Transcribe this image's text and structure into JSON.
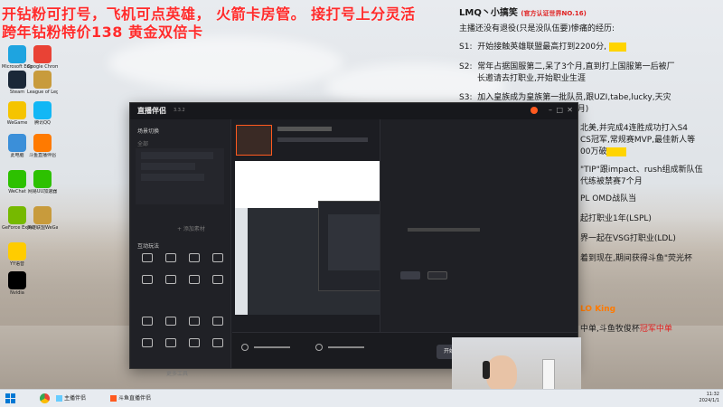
{
  "overlay": {
    "line1": "开钻粉可打号，飞机可点英雄，  火箭卡房管。  接打号上分灵活",
    "line2": "跨年钻粉特价138   黄金双倍卡"
  },
  "info_panel": {
    "title": "LMQ丶小搞笑",
    "title_tag": "(官方认证世界NO.16)",
    "subtitle": "主播还没有退役(只是没队伍要)惨痛的经历:",
    "s1_label": "S1:",
    "s1_text": "开始接触英雄联盟最高打到2200分,",
    "s2_label": "S2:",
    "s2_text": "常年占据国服第二,呆了3个月,直到打上国服第一后被厂",
    "s2_text2": "长邀请去打职业,开始职业生涯",
    "s3_label": "S3:",
    "s3_text": "加入皇族成为皇族第一批队员,跟UZI,tabe,lucky,天灾",
    "s3_text2": "3个月)",
    "line_a": "北美,并完成4连胜成功打入S4",
    "line_b": "CS冠军,常规赛MVP,最佳新人等",
    "line_c": "00万破",
    "line_d": "\"TIP\"跟impact、rush组成新队伍",
    "line_e": "代练被禁赛7个月",
    "line_f": "PL OMD战队当",
    "line_g": "起打职业1年(LSPL)",
    "line_h": "界一起在VSG打职业(LDL)",
    "line_i": "着到现在,期间获得斗鱼\"荧光杯",
    "line_j": "LO King",
    "line_k": "中单,斗鱼牧俊杯",
    "line_k_hl": "冠军中单"
  },
  "desktop_icons": [
    {
      "label": "Microsoft Edge",
      "color": "#1ea4e0"
    },
    {
      "label": "Google Chrome",
      "color": "#e94235"
    },
    {
      "label": "Steam",
      "color": "#1b2838"
    },
    {
      "label": "League of Legends",
      "color": "#c89b3c"
    },
    {
      "label": "WeGame",
      "color": "#f5c400"
    },
    {
      "label": "腾讯QQ",
      "color": "#12b7f5"
    },
    {
      "label": "此电脑",
      "color": "#3b8fd9"
    },
    {
      "label": "斗鱼直播伴侣",
      "color": "#ff7a00"
    },
    {
      "label": "WeChat",
      "color": "#2dc100"
    },
    {
      "label": "网易UU加速器",
      "color": "#2dc100"
    },
    {
      "label": "GeForce Experience",
      "color": "#76b900"
    },
    {
      "label": "英雄联盟WeGame版",
      "color": "#c89b3c"
    },
    {
      "label": "YY语音",
      "color": "#ffcc00"
    },
    {
      "label": "Nvidia",
      "color": "#000"
    }
  ],
  "app": {
    "brand": "直播伴侣",
    "version": "3.3.2",
    "sidebar": {
      "scene_label": "场景切换",
      "tab_all": "全部",
      "source_label": "素材管理",
      "add_source": "+ 添加素材",
      "tools_label": "互动玩法",
      "more_tools": "更多工具"
    },
    "start_button": "开始直播"
  },
  "taskbar": {
    "app1": "主播伴侣",
    "app2": "斗鱼直播伴侣",
    "time": "11:32",
    "date": "2024/1/1"
  }
}
